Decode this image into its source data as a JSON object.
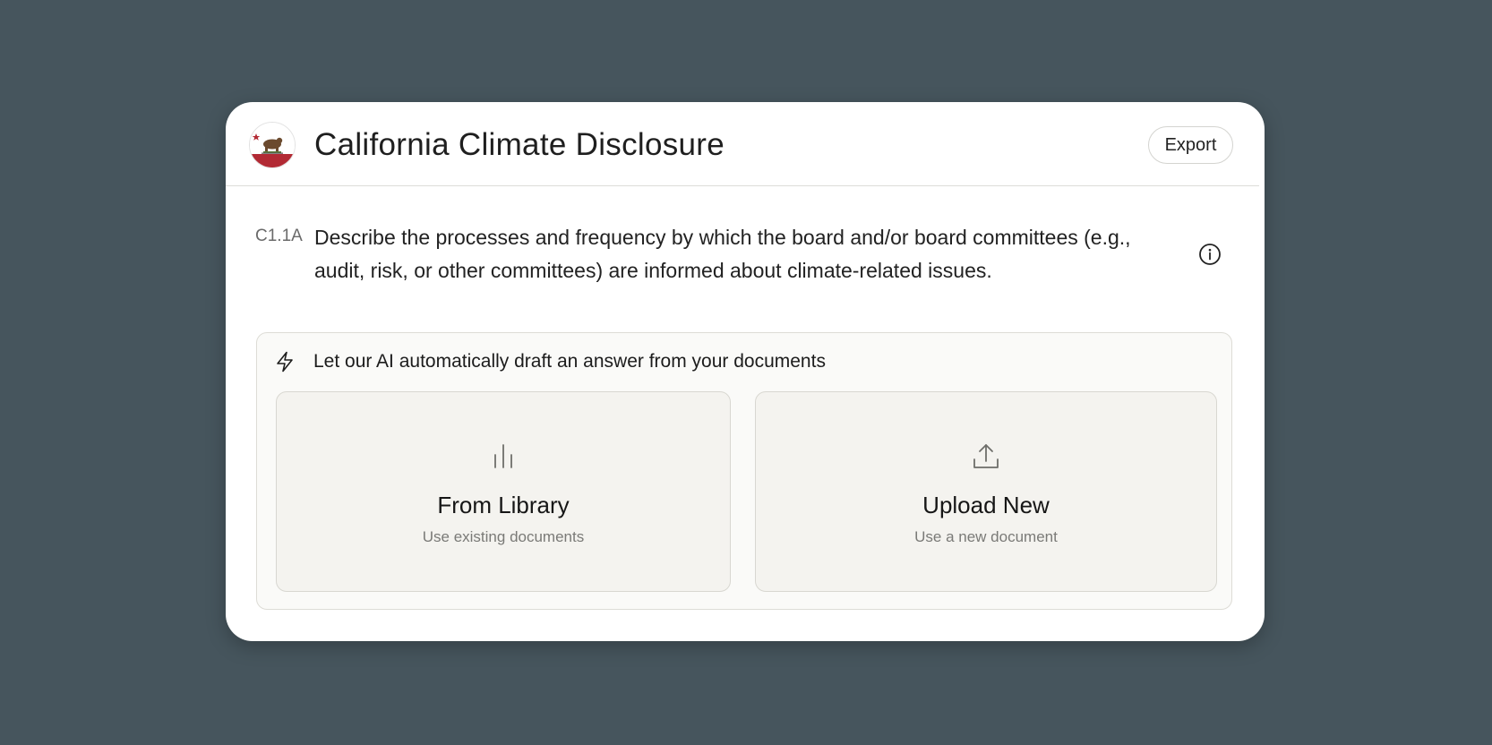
{
  "header": {
    "title": "California Climate Disclosure",
    "export_label": "Export",
    "logo_icon": "california-flag-logo"
  },
  "question": {
    "id": "C1.1A",
    "text": "Describe the processes and frequency by which the board and/or board committees (e.g., audit, risk, or other committees) are informed about climate-related issues.",
    "info_icon": "info-icon"
  },
  "ai_panel": {
    "icon": "lightning-icon",
    "text": "Let our AI automatically draft an answer from your documents",
    "options": [
      {
        "icon": "library-icon",
        "title": "From Library",
        "subtitle": "Use existing documents"
      },
      {
        "icon": "upload-icon",
        "title": "Upload New",
        "subtitle": "Use a new document"
      }
    ]
  },
  "colors": {
    "background": "#46555d",
    "card": "#ffffff",
    "panel": "#fafaf8",
    "option": "#f4f3ef",
    "flag_red": "#b22a34"
  }
}
